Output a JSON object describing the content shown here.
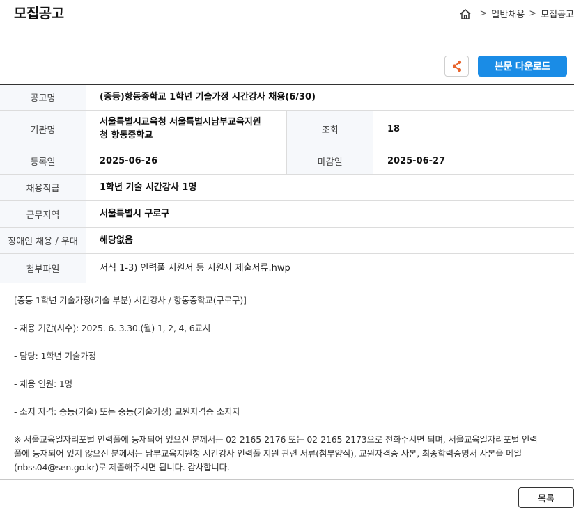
{
  "header": {
    "title": "모집공고",
    "breadcrumb": [
      "일반채용",
      "모집공고"
    ]
  },
  "actions": {
    "download_label": "본문 다운로드",
    "list_label": "목록"
  },
  "info": {
    "notice_label": "공고명",
    "notice_value": "(중등)항동중학교 1학년 기술가정 시간강사 채용(6/30)",
    "org_label": "기관명",
    "org_value_line1": "서울특별시교육청 서울특별시남부교육지원",
    "org_value_line2": "청 항동중학교",
    "views_label": "조회",
    "views_value": "18",
    "reg_label": "등록일",
    "reg_value": "2025-06-26",
    "deadline_label": "마감일",
    "deadline_value": "2025-06-27",
    "position_label": "채용직급",
    "position_value": "1학년 기술 시간강사 1명",
    "region_label": "근무지역",
    "region_value": "서울특별시 구로구",
    "disability_label": "장애인 채용 / 우대",
    "disability_value": "해당없음",
    "attach_label": "첨부파일",
    "attach_value": "서식 1-3) 인력풀 지원서 등 지원자 제출서류.hwp"
  },
  "body": {
    "line1": "[중등 1학년 기술가정(기술 부분) 시간강사 / 항동중학교(구로구)]",
    "line2": "- 채용 기간(시수): 2025. 6. 3.30.(월) 1, 2, 4, 6교시",
    "line3": "- 담당: 1학년 기술가정",
    "line4": "- 채용 인원: 1명",
    "line5": "- 소지 자격: 중등(기술) 또는 중등(기술가정) 교원자격증 소지자",
    "notice_line1": "※ 서울교육일자리포털 인력풀에 등재되어 있으신 분께서는 02-2165-2176 또는 02-2165-2173으로 전화주시면 되며, 서울교육일자리포털 인력",
    "notice_line2": "풀에 등재되어 있지 않으신 분께서는 남부교육지원청 시간강사 인력풀 지원 관련 서류(첨부양식), 교원자격증 사본, 최종학력증명서 사본을 메일",
    "notice_line3": "(nbss04@sen.go.kr)로 제출해주시면 됩니다. 감사합니다."
  },
  "icons": {
    "home": "home-icon",
    "share": "share-icon",
    "share_color": "#e8642c",
    "accent": "#1a8ce6"
  }
}
